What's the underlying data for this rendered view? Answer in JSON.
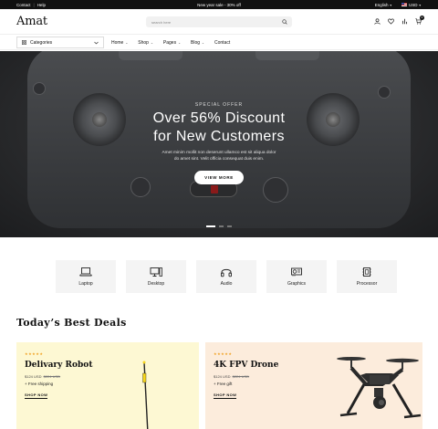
{
  "topbar": {
    "links": [
      "Contact",
      "Help"
    ],
    "promo": "New year sale - 30% off",
    "language": "English",
    "currency": "USD"
  },
  "header": {
    "logo": "Amat",
    "search_placeholder": "search here",
    "cart_count": "0",
    "icons": [
      "user-icon",
      "heart-icon",
      "compare-icon",
      "cart-icon"
    ]
  },
  "nav": {
    "categories_label": "Categories",
    "links": [
      {
        "label": "Home",
        "has_menu": true
      },
      {
        "label": "Shop",
        "has_menu": true
      },
      {
        "label": "Pages",
        "has_menu": true
      },
      {
        "label": "Blog",
        "has_menu": true
      },
      {
        "label": "Contact",
        "has_menu": false
      }
    ]
  },
  "hero": {
    "eyebrow": "SPECIAL OFFER",
    "headline_line1": "Over 56% Discount",
    "headline_line2": "for New Customers",
    "sub_line1": "Amet minim mollit non deserunt ullamco est sit aliqua dolor",
    "sub_line2": "do amet sint. Velit officia consequat duis enim.",
    "cta": "VIEW MORE",
    "slides": 3,
    "active_slide": 1
  },
  "categories": [
    {
      "label": "Laptop",
      "icon": "laptop-icon"
    },
    {
      "label": "Desktop",
      "icon": "desktop-icon"
    },
    {
      "label": "Audio",
      "icon": "headphones-icon"
    },
    {
      "label": "Graphics",
      "icon": "graphics-card-icon"
    },
    {
      "label": "Processor",
      "icon": "processor-icon"
    }
  ],
  "deals": {
    "title": "Today’s Best Deals",
    "items": [
      {
        "stars": "★★★★★",
        "name": "Delivary Robot",
        "price": "$124 USD",
        "old_price": "$224 USD",
        "extra": "+ Free shipping",
        "link": "SHOP NOW",
        "bg": "#fdf8d3"
      },
      {
        "stars": "★★★★★",
        "name": "4K FPV Drone",
        "price": "$124 USD",
        "old_price": "$224 USD",
        "extra": "+ Free gift",
        "link": "SHOP NOW",
        "bg": "#fcecdc"
      }
    ]
  },
  "colors": {
    "accent": "#111111",
    "star": "#f0a020"
  }
}
